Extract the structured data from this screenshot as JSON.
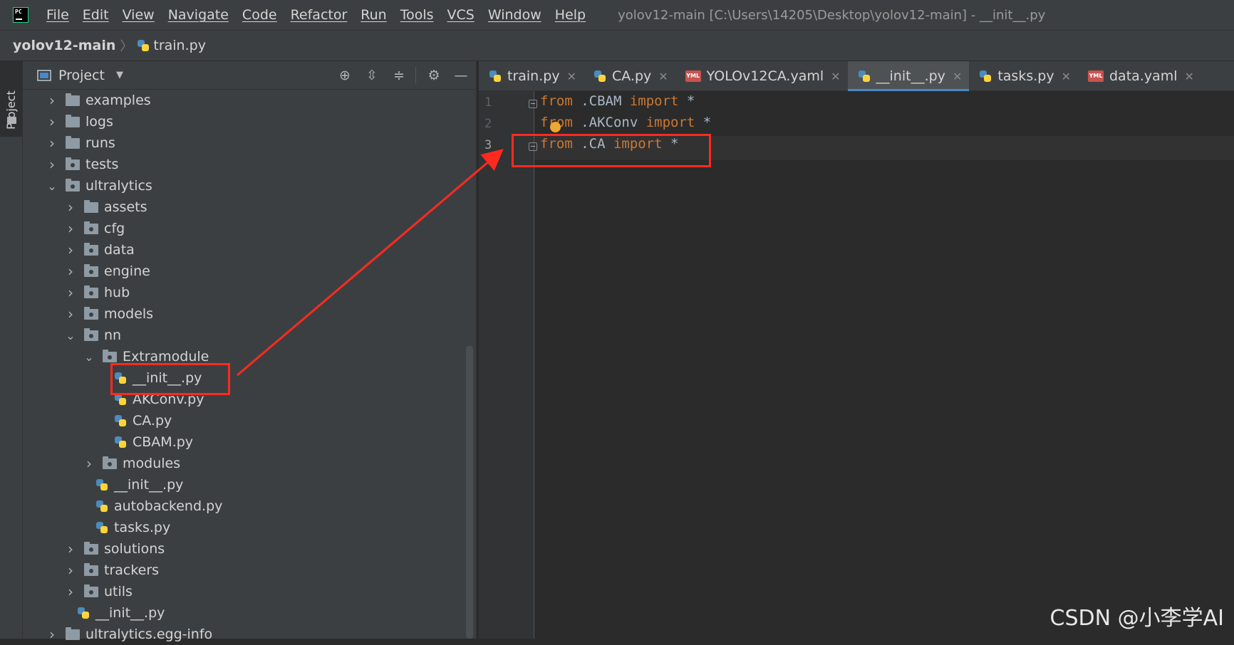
{
  "menubar": {
    "items": [
      "File",
      "Edit",
      "View",
      "Navigate",
      "Code",
      "Refactor",
      "Run",
      "Tools",
      "VCS",
      "Window",
      "Help"
    ],
    "window_title": "yolov12-main [C:\\Users\\14205\\Desktop\\yolov12-main] - __init__.py"
  },
  "navbar": {
    "project": "yolov12-main",
    "file": "train.py"
  },
  "stripe": {
    "label": "Project"
  },
  "panel": {
    "title": "Project",
    "tree": [
      {
        "label": "examples",
        "type": "folder",
        "indent": 0,
        "expanded": false
      },
      {
        "label": "logs",
        "type": "folder",
        "indent": 0,
        "expanded": false
      },
      {
        "label": "runs",
        "type": "folder",
        "indent": 0,
        "expanded": false
      },
      {
        "label": "tests",
        "type": "package",
        "indent": 0,
        "expanded": false
      },
      {
        "label": "ultralytics",
        "type": "package",
        "indent": 0,
        "expanded": true
      },
      {
        "label": "assets",
        "type": "folder",
        "indent": 1,
        "expanded": false
      },
      {
        "label": "cfg",
        "type": "package",
        "indent": 1,
        "expanded": false
      },
      {
        "label": "data",
        "type": "package",
        "indent": 1,
        "expanded": false
      },
      {
        "label": "engine",
        "type": "package",
        "indent": 1,
        "expanded": false
      },
      {
        "label": "hub",
        "type": "package",
        "indent": 1,
        "expanded": false
      },
      {
        "label": "models",
        "type": "package",
        "indent": 1,
        "expanded": false
      },
      {
        "label": "nn",
        "type": "package",
        "indent": 1,
        "expanded": true
      },
      {
        "label": "Extramodule",
        "type": "package",
        "indent": 2,
        "expanded": true
      },
      {
        "label": "__init__.py",
        "type": "py",
        "indent": 3
      },
      {
        "label": "AKConv.py",
        "type": "py",
        "indent": 3
      },
      {
        "label": "CA.py",
        "type": "py",
        "indent": 3
      },
      {
        "label": "CBAM.py",
        "type": "py",
        "indent": 3
      },
      {
        "label": "modules",
        "type": "package",
        "indent": 2,
        "expanded": false
      },
      {
        "label": "__init__.py",
        "type": "py",
        "indent": 2
      },
      {
        "label": "autobackend.py",
        "type": "py",
        "indent": 2
      },
      {
        "label": "tasks.py",
        "type": "py",
        "indent": 2
      },
      {
        "label": "solutions",
        "type": "package",
        "indent": 1,
        "expanded": false
      },
      {
        "label": "trackers",
        "type": "package",
        "indent": 1,
        "expanded": false
      },
      {
        "label": "utils",
        "type": "package",
        "indent": 1,
        "expanded": false
      },
      {
        "label": "__init__.py",
        "type": "py",
        "indent": 1
      },
      {
        "label": "ultralytics.egg-info",
        "type": "folder",
        "indent": 0,
        "expanded": false
      }
    ]
  },
  "tabs": [
    {
      "label": "train.py",
      "icon": "py"
    },
    {
      "label": "CA.py",
      "icon": "py"
    },
    {
      "label": "YOLOv12CA.yaml",
      "icon": "yml"
    },
    {
      "label": "__init__.py",
      "icon": "py",
      "active": true
    },
    {
      "label": "tasks.py",
      "icon": "py"
    },
    {
      "label": "data.yaml",
      "icon": "yml"
    }
  ],
  "editor": {
    "lines": [
      {
        "num": "1",
        "kw1": "from",
        "mod": " .CBAM ",
        "kw2": "import",
        "rest": " *"
      },
      {
        "num": "2",
        "kw1": "from",
        "mod": " .AKConv ",
        "kw2": "import",
        "rest": " *"
      },
      {
        "num": "3",
        "kw1": "from",
        "mod": " .CA ",
        "kw2": "import",
        "rest": " *"
      }
    ],
    "current_line": 3
  },
  "watermark": "CSDN @小李学AI",
  "colors": {
    "annotation": "#ff2a1f",
    "keyword": "#cc7832"
  }
}
